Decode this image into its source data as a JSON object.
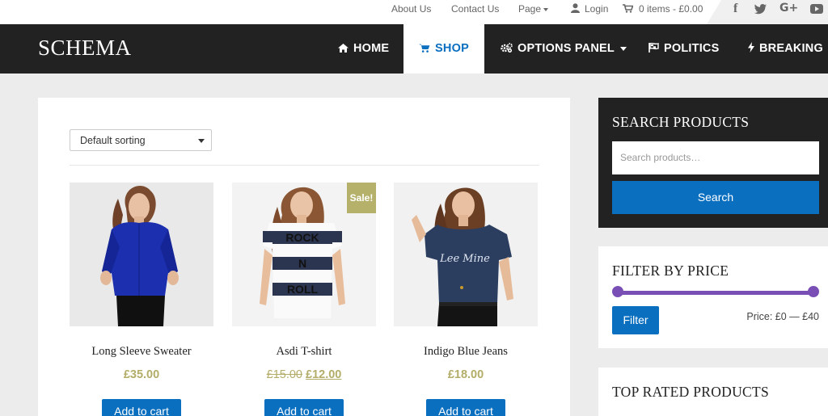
{
  "topbar": {
    "about": "About Us",
    "contact": "Contact Us",
    "page": "Page",
    "login": "Login",
    "cart": "0 items - £0.00",
    "social": [
      "facebook-icon",
      "twitter-icon",
      "google-plus-icon",
      "youtube-icon"
    ]
  },
  "nav": {
    "logo": "SCHEMA",
    "items": [
      {
        "label": "HOME",
        "icon": "home-icon"
      },
      {
        "label": "SHOP",
        "icon": "cart-icon",
        "active": true
      },
      {
        "label": "OPTIONS PANEL",
        "icon": "cogs-icon"
      },
      {
        "label": "POLITICS",
        "icon": "flag-icon"
      },
      {
        "label": "BREAKING",
        "icon": "bolt-icon"
      }
    ]
  },
  "shop": {
    "sorting": "Default sorting",
    "products": [
      {
        "name": "Long Sleeve Sweater",
        "price": "£35.00",
        "button": "Add to cart"
      },
      {
        "name": "Asdi T-shirt",
        "old_price": "£15.00",
        "price": "£12.00",
        "badge": "Sale!",
        "button": "Add to cart"
      },
      {
        "name": "Indigo Blue Jeans",
        "price": "£18.00",
        "button": "Add to cart"
      }
    ]
  },
  "sidebar": {
    "search_title": "SEARCH PRODUCTS",
    "search_placeholder": "Search products…",
    "search_button": "Search",
    "filter_title": "FILTER BY PRICE",
    "filter_button": "Filter",
    "price_range": "Price: £0 — £40",
    "top_rated_title": "TOP RATED PRODUCTS"
  },
  "colors": {
    "accent": "#0b6fc0",
    "sale": "#b5b16b",
    "slider": "#7a4fb5",
    "dark": "#222222"
  }
}
